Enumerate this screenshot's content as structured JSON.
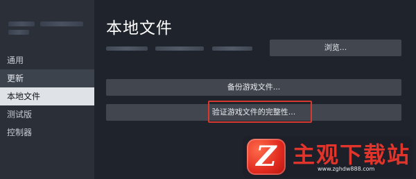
{
  "sidebar": {
    "items": [
      {
        "label": "通用"
      },
      {
        "label": "更新"
      },
      {
        "label": "本地文件"
      },
      {
        "label": "测试版"
      },
      {
        "label": "控制器"
      }
    ]
  },
  "main": {
    "title": "本地文件",
    "browse_label": "浏览...",
    "backup_label": "备份游戏文件...",
    "verify_label": "验证游戏文件的完整性..."
  },
  "watermark": {
    "title": "主观下载站",
    "url": "www.zghdw888.com",
    "logo_letter": "Z"
  }
}
